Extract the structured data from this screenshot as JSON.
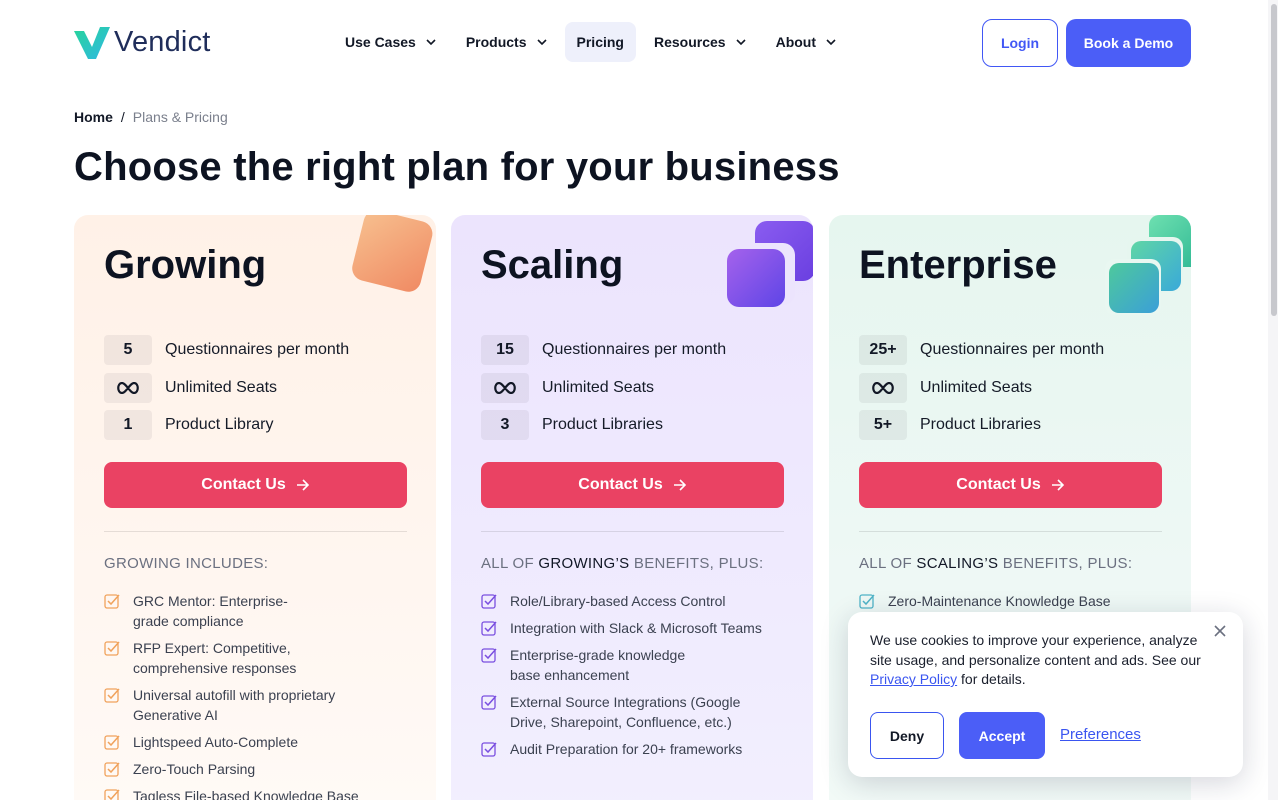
{
  "brand": {
    "name": "Vendict"
  },
  "nav": {
    "items": [
      {
        "label": "Use Cases",
        "has_dropdown": true
      },
      {
        "label": "Products",
        "has_dropdown": true
      },
      {
        "label": "Pricing",
        "has_dropdown": false,
        "active": true
      },
      {
        "label": "Resources",
        "has_dropdown": true
      },
      {
        "label": "About",
        "has_dropdown": true
      }
    ],
    "login_label": "Login",
    "demo_label": "Book a Demo"
  },
  "breadcrumb": {
    "home": "Home",
    "separator": "/",
    "current": "Plans & Pricing"
  },
  "page_title": "Choose the right plan for your business",
  "plans": [
    {
      "name": "Growing",
      "stats": [
        {
          "value": "5",
          "label": "Questionnaires per month"
        },
        {
          "value": "∞",
          "label": "Unlimited Seats"
        },
        {
          "value": "1",
          "label": "Product Library"
        }
      ],
      "cta": "Contact Us",
      "includes_prefix": "GROWING INCLUDES:",
      "includes_highlight": "",
      "includes_suffix": "",
      "features": [
        "GRC Mentor: Enterprise-grade compliance",
        "RFP Expert: Competitive, comprehensive responses",
        "Universal autofill with proprietary Generative AI",
        "Lightspeed Auto-Complete",
        "Zero-Touch Parsing",
        "Tagless File-based Knowledge Base"
      ]
    },
    {
      "name": "Scaling",
      "stats": [
        {
          "value": "15",
          "label": "Questionnaires per month"
        },
        {
          "value": "∞",
          "label": "Unlimited Seats"
        },
        {
          "value": "3",
          "label": "Product Libraries"
        }
      ],
      "cta": "Contact Us",
      "includes_prefix": "ALL OF ",
      "includes_highlight": "GROWING’S",
      "includes_suffix": " BENEFITS, PLUS:",
      "features": [
        "Role/Library-based Access Control",
        "Integration with Slack & Microsoft Teams",
        "Enterprise-grade knowledge base enhancement",
        "External Source Integrations (Google Drive, Sharepoint, Confluence, etc.)",
        "Audit Preparation for 20+ frameworks"
      ]
    },
    {
      "name": "Enterprise",
      "stats": [
        {
          "value": "25+",
          "label": "Questionnaires per month"
        },
        {
          "value": "∞",
          "label": "Unlimited Seats"
        },
        {
          "value": "5+",
          "label": "Product Libraries"
        }
      ],
      "cta": "Contact Us",
      "includes_prefix": "ALL OF ",
      "includes_highlight": "SCALING’S",
      "includes_suffix": " BENEFITS, PLUS:",
      "features": [
        "Zero-Maintenance Knowledge Base"
      ]
    }
  ],
  "cookie": {
    "text_before": "We use cookies to improve your experience, analyze site usage, and personalize content and ads. See our ",
    "link": "Privacy Policy",
    "text_after": " for details.",
    "deny": "Deny",
    "accept": "Accept",
    "preferences": "Preferences"
  },
  "colors": {
    "primary": "#4b5ef7",
    "cta": "#ea4263",
    "growing_check": "#f0a25c",
    "scaling_check": "#7a4fe0",
    "enterprise_check": "#4fb3c7"
  }
}
